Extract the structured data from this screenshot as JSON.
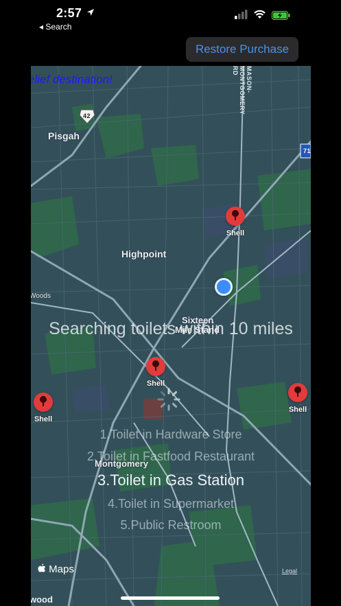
{
  "status_bar": {
    "time": "2:57",
    "back_label": "◂ Search"
  },
  "toolbar": {
    "restore_label": "Restore Purchase"
  },
  "map": {
    "destination_text": "elief destination!",
    "places": {
      "pisgah": "Pisgah",
      "highpoint": "Highpoint",
      "woods_left": "Woods",
      "sixteen": "Sixteen",
      "mile_stand": "Mile Stand",
      "montgomery": "Montgomery",
      "wood_bottom": "wood"
    },
    "road_labels": {
      "route_42": "42",
      "route_71": "71",
      "mason_montgomery": "MASON-MONTGOMERY RD"
    },
    "pins": [
      {
        "label": "Shell"
      },
      {
        "label": "Shell"
      },
      {
        "label": "Shell"
      },
      {
        "label": "Shell"
      }
    ],
    "searching_text": "Searching toilets within 10 miles",
    "options": [
      "1.Toilet in Hardware Store",
      "2.Toilet in Fastfood Restaurant",
      "3.Toilet in Gas Station",
      "4.Toilet in Supermarket",
      "5.Public Restroom"
    ],
    "selected_option_index": 2,
    "maps_brand": "Maps",
    "legal_label": "Legal"
  },
  "colors": {
    "accent_blue": "#4a90f0",
    "pin_red": "#e23b3b",
    "user_location": "#3a8cff",
    "destination_text": "#1a1aff"
  }
}
